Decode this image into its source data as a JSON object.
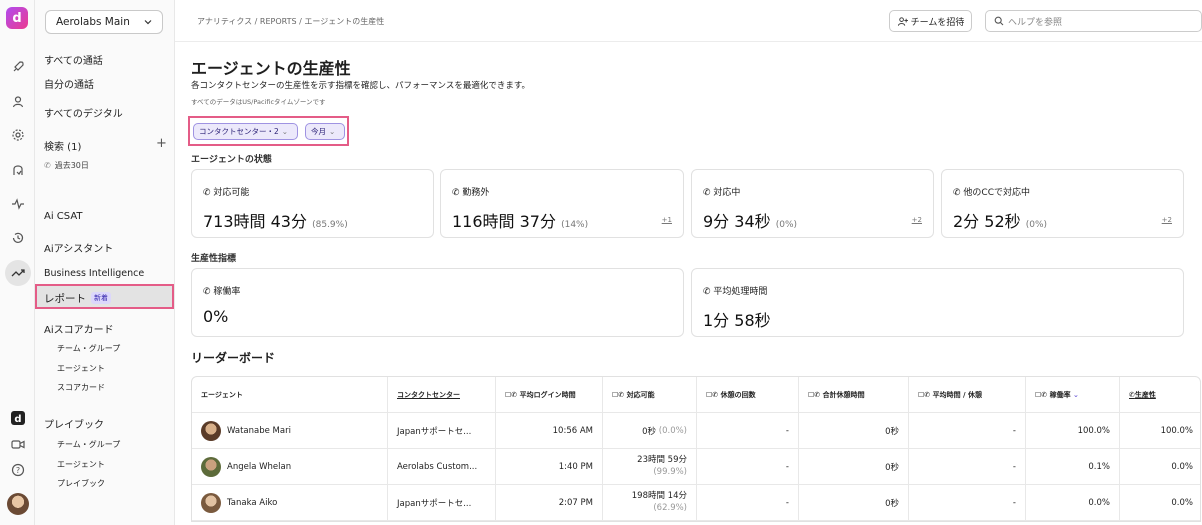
{
  "workspace": "Aerolabs Main",
  "sidebar": {
    "all_calls": "すべての通話",
    "my_calls": "自分の通話",
    "all_digital": "すべてのデジタル",
    "search": "検索 (1)",
    "search_add": "+",
    "past_30": "過去30日",
    "ai_csat": "Ai CSAT",
    "ai_assistant": "Aiアシスタント",
    "business_intel": "Business Intelligence",
    "report": "レポート",
    "report_badge": "新着",
    "ai_scorecard": "Aiスコアカード",
    "sc_team": "チーム・グループ",
    "sc_agent": "エージェント",
    "sc_scorecard": "スコアカード",
    "playbook": "プレイブック",
    "pb_team": "チーム・グループ",
    "pb_agent": "エージェント",
    "pb_playbook": "プレイブック"
  },
  "topbar": {
    "breadcrumb": "アナリティクス / REPORTS / エージェントの生産性",
    "invite": "チームを招待",
    "search_placeholder": "ヘルプを参照"
  },
  "page": {
    "title": "エージェントの生産性",
    "description": "各コンタクトセンターの生産性を示す指標を確認し、パフォーマンスを最適化できます。",
    "timezone": "すべてのデータはUS/Pacificタイムゾーンです",
    "filter_cc": "コンタクトセンター・2",
    "filter_month": "今月",
    "status_title": "エージェントの状態",
    "metrics_title": "生産性指標",
    "leaderboard_title": "リーダーボード"
  },
  "status_cards": [
    {
      "label": "対応可能",
      "value": "713時間 43分",
      "pct": "(85.9%)",
      "more": ""
    },
    {
      "label": "勤務外",
      "value": "116時間 37分",
      "pct": "(14%)",
      "more": "+1"
    },
    {
      "label": "対応中",
      "value": "9分 34秒",
      "pct": "(0%)",
      "more": "+2"
    },
    {
      "label": "他のCCで対応中",
      "value": "2分 52秒",
      "pct": "(0%)",
      "more": "+2"
    }
  ],
  "metric_cards": [
    {
      "label": "稼働率",
      "value": "0%"
    },
    {
      "label": "平均処理時間",
      "value": "1分 58秒"
    }
  ],
  "table": {
    "headers": [
      "エージェント",
      "コンタクトセンター",
      "平均ログイン時間",
      "対応可能",
      "休憩の回数",
      "合計休憩時間",
      "平均時間 / 休憩",
      "稼働率",
      "生産性"
    ],
    "rows": [
      {
        "agent": "Watanabe Mari",
        "cc": "Japanサポートセ...",
        "login": "10:56 AM",
        "avail": "0秒",
        "avail_pct": "(0.0%)",
        "breaks": "-",
        "total_break": "0秒",
        "avg_break": "-",
        "util": "100.0%",
        "prod": "100.0%"
      },
      {
        "agent": "Angela Whelan",
        "cc": "Aerolabs Custom...",
        "login": "1:40 PM",
        "avail": "23時間 59分",
        "avail_pct": "(99.9%)",
        "breaks": "-",
        "total_break": "0秒",
        "avg_break": "-",
        "util": "0.1%",
        "prod": "0.0%"
      },
      {
        "agent": "Tanaka Aiko",
        "cc": "Japanサポートセ...",
        "login": "2:07 PM",
        "avail": "198時間 14分",
        "avail_pct": "(62.9%)",
        "breaks": "-",
        "total_break": "0秒",
        "avg_break": "-",
        "util": "0.0%",
        "prod": "0.0%"
      }
    ]
  },
  "colors": {
    "accent": "#e45c87",
    "chip": "#ece9fb",
    "brand": "#b04cf0"
  }
}
